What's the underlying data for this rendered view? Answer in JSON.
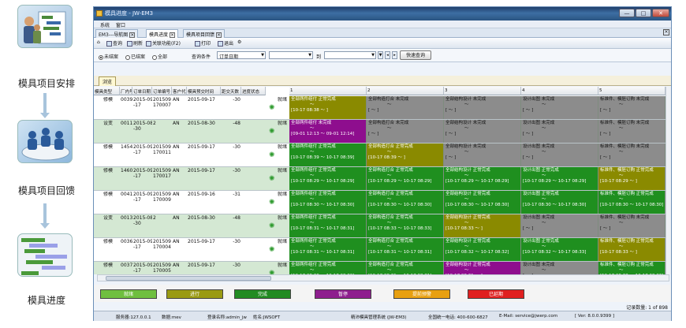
{
  "sidebar": {
    "items": [
      {
        "label": "模具项目安排",
        "icon": "schedule-people-icon"
      },
      {
        "label": "模具项目回馈",
        "icon": "meeting-feedback-icon"
      },
      {
        "label": "模具进度",
        "icon": "gantt-progress-icon"
      }
    ]
  },
  "window": {
    "title": "模具进度 - JW-EM3",
    "minimize": "—",
    "maximize": "□",
    "close": "✕"
  },
  "menu": {
    "system": "系统",
    "window": "窗口"
  },
  "tabs": [
    {
      "label": "EM3---导航图",
      "active": false
    },
    {
      "label": "模具进度",
      "active": true
    },
    {
      "label": "模具项目回馈",
      "active": false
    }
  ],
  "toolbar": {
    "query": "查询",
    "refresh": "刷新",
    "related": "关联功能(F2)",
    "print": "打印",
    "exit": "退出"
  },
  "filter": {
    "radio_incomplete": "未结案",
    "radio_complete": "已结案",
    "radio_all": "全部",
    "quick_label": "查询条件",
    "field_value": "订单日期",
    "to_label": "到",
    "quick_query": "快速查询"
  },
  "browse_tab": "浏览",
  "columns": {
    "type": "模具类型",
    "factory": "厂内号",
    "order_date": "订单日期",
    "order_no": "订单编号",
    "customer": "客户代号",
    "delivery": "模具预交时间",
    "days": "距交天数",
    "progress": "进度状态",
    "c1": "1",
    "c2": "2",
    "c3": "3",
    "c4": "4",
    "c5": "5"
  },
  "rows": [
    {
      "type": "修模",
      "factory": "0039",
      "date1": "2015-09",
      "date2": "-17",
      "order1": "201509",
      "order2": "170007",
      "cust": "AN",
      "delivery": "2015-09-17",
      "days": "-30",
      "status": "就绪",
      "stages": [
        {
          "l1": "全部两件组付 正常完成",
          "l2": "～",
          "l3": "[10-17 08:38 ～  ]",
          "color": "#8a8a00"
        },
        {
          "l1": "全部构造打合 未完成",
          "l2": "～",
          "l3": "[  ～  ]",
          "color": "#8c8c8c"
        },
        {
          "l1": "全部结构设计 未完成",
          "l2": "～",
          "l3": "[  ～  ]",
          "color": "#8c8c8c"
        },
        {
          "l1": "设计出图 未完成",
          "l2": "～",
          "l3": "[  ～  ]",
          "color": "#8c8c8c"
        },
        {
          "l1": "标准件、模胚订购 未完成",
          "l2": "～",
          "l3": "[  ～  ]",
          "color": "#8c8c8c"
        }
      ]
    },
    {
      "type": "设变",
      "factory": "0011",
      "date1": "2015-08",
      "date2": "-30",
      "order1": "2",
      "order2": "",
      "cust": "AN",
      "delivery": "2015-08-30",
      "days": "-48",
      "status": "就绪",
      "stages": [
        {
          "l1": "全部两件组付 未完成",
          "l2": "～",
          "l3": "[09-01 12:13 ～ 09-01 12:14]",
          "color": "#8e0e8e"
        },
        {
          "l1": "全部构造打合 未完成",
          "l2": "～",
          "l3": "[  ～  ]",
          "color": "#8c8c8c"
        },
        {
          "l1": "全部结构设计 未完成",
          "l2": "～",
          "l3": "[  ～  ]",
          "color": "#8c8c8c"
        },
        {
          "l1": "设计出图 未完成",
          "l2": "～",
          "l3": "[  ～  ]",
          "color": "#8c8c8c"
        },
        {
          "l1": "标准件、模胚订购 未完成",
          "l2": "～",
          "l3": "[  ～  ]",
          "color": "#8c8c8c"
        }
      ]
    },
    {
      "type": "修模",
      "factory": "1454",
      "date1": "2015-09",
      "date2": "-17",
      "order1": "201509",
      "order2": "170011",
      "cust": "AN",
      "delivery": "2015-09-17",
      "days": "-30",
      "status": "就绪",
      "stages": [
        {
          "l1": "全部两件组付 正常完成",
          "l2": "～",
          "l3": "[10-17 08:39 ～ 10-17 08:39]",
          "color": "#1f8f1f"
        },
        {
          "l1": "全部构造打合 正常完成",
          "l2": "～",
          "l3": "[10-17 08:39 ～  ]",
          "color": "#8a8a00"
        },
        {
          "l1": "全部结构设计 未完成",
          "l2": "～",
          "l3": "[  ～  ]",
          "color": "#8c8c8c"
        },
        {
          "l1": "设计出图 未完成",
          "l2": "～",
          "l3": "[  ～  ]",
          "color": "#8c8c8c"
        },
        {
          "l1": "标准件、模胚订购 未完成",
          "l2": "～",
          "l3": "[  ～  ]",
          "color": "#8c8c8c"
        }
      ]
    },
    {
      "type": "修模",
      "factory": "1460",
      "date1": "2015-09",
      "date2": "-17",
      "order1": "201509",
      "order2": "170017",
      "cust": "AN",
      "delivery": "2015-09-17",
      "days": "-30",
      "status": "就绪",
      "stages": [
        {
          "l1": "全部两件组付 正常完成",
          "l2": "～",
          "l3": "[10-17 08:29 ～ 10-17 08:29]",
          "color": "#1f8f1f"
        },
        {
          "l1": "全部构造打合 正常完成",
          "l2": "～",
          "l3": "[10-17 08:29 ～ 10-17 08:29]",
          "color": "#1f8f1f"
        },
        {
          "l1": "全部结构设计 正常完成",
          "l2": "～",
          "l3": "[10-17 08:29 ～ 10-17 08:29]",
          "color": "#1f8f1f"
        },
        {
          "l1": "设计出图 正常完成",
          "l2": "～",
          "l3": "[10-17 08:29 ～ 10-17 08:29]",
          "color": "#1f8f1f"
        },
        {
          "l1": "标准件、模胚订购 正常完成",
          "l2": "～",
          "l3": "[10-17 08:29 ～  ]",
          "color": "#8a8a00"
        }
      ]
    },
    {
      "type": "修模",
      "factory": "0041",
      "date1": "2015-09",
      "date2": "-17",
      "order1": "201509",
      "order2": "170009",
      "cust": "AN",
      "delivery": "2015-09-16",
      "days": "-31",
      "status": "就绪",
      "stages": [
        {
          "l1": "全部两件组付 正常完成",
          "l2": "～",
          "l3": "[10-17 08:30 ～ 10-17 08:30]",
          "color": "#1f8f1f"
        },
        {
          "l1": "全部构造打合 正常完成",
          "l2": "～",
          "l3": "[10-17 08:30 ～ 10-17 08:30]",
          "color": "#1f8f1f"
        },
        {
          "l1": "全部结构设计 正常完成",
          "l2": "～",
          "l3": "[10-17 08:30 ～ 10-17 08:30]",
          "color": "#1f8f1f"
        },
        {
          "l1": "设计出图 正常完成",
          "l2": "～",
          "l3": "[10-17 08:30 ～ 10-17 08:30]",
          "color": "#1f8f1f"
        },
        {
          "l1": "标准件、模胚订购 正常完成",
          "l2": "～",
          "l3": "[10-17 08:30 ～ 10-17 08:30]",
          "color": "#1f8f1f"
        }
      ]
    },
    {
      "type": "设变",
      "factory": "0013",
      "date1": "2015-08",
      "date2": "-30",
      "order1": "2",
      "order2": "",
      "cust": "AN",
      "delivery": "2015-08-30",
      "days": "-48",
      "status": "就绪",
      "stages": [
        {
          "l1": "全部两件组付 正常完成",
          "l2": "～",
          "l3": "[10-17 08:31 ～ 10-17 08:31]",
          "color": "#1f8f1f"
        },
        {
          "l1": "全部构造打合 正常完成",
          "l2": "～",
          "l3": "[10-17 08:33 ～ 10-17 08:33]",
          "color": "#1f8f1f"
        },
        {
          "l1": "全部结构设计 正常完成",
          "l2": "～",
          "l3": "[10-17 08:33 ～  ]",
          "color": "#8a8a00"
        },
        {
          "l1": "设计出图 未完成",
          "l2": "～",
          "l3": "[  ～  ]",
          "color": "#8c8c8c"
        },
        {
          "l1": "标准件、模胚订购 未完成",
          "l2": "～",
          "l3": "[  ～  ]",
          "color": "#8c8c8c"
        }
      ]
    },
    {
      "type": "修模",
      "factory": "0036",
      "date1": "2015-09",
      "date2": "-17",
      "order1": "201509",
      "order2": "170004",
      "cust": "AN",
      "delivery": "2015-09-17",
      "days": "-30",
      "status": "就绪",
      "stages": [
        {
          "l1": "全部两件组付 正常完成",
          "l2": "～",
          "l3": "[10-17 08:31 ～ 10-17 08:31]",
          "color": "#1f8f1f"
        },
        {
          "l1": "全部构造打合 正常完成",
          "l2": "～",
          "l3": "[10-17 08:31 ～ 10-17 08:31]",
          "color": "#1f8f1f"
        },
        {
          "l1": "全部结构设计 正常完成",
          "l2": "～",
          "l3": "[10-17 08:32 ～ 10-17 08:32]",
          "color": "#1f8f1f"
        },
        {
          "l1": "设计出图 正常完成",
          "l2": "～",
          "l3": "[10-17 08:32 ～ 10-17 08:33]",
          "color": "#1f8f1f"
        },
        {
          "l1": "标准件、模胚订购 正常完成",
          "l2": "～",
          "l3": "[10-17 08:33 ～  ]",
          "color": "#8a8a00"
        }
      ]
    },
    {
      "type": "修模",
      "factory": "0037",
      "date1": "2015-09",
      "date2": "-17",
      "order1": "201509",
      "order2": "170005",
      "cust": "AN",
      "delivery": "2015-09-17",
      "days": "-30",
      "status": "就绪",
      "stages": [
        {
          "l1": "全部两件组付 正常完成",
          "l2": "～",
          "l3": "[10-17 08:30 ～ 10-17 08:30]",
          "color": "#1f8f1f"
        },
        {
          "l1": "全部构造打合 正常完成",
          "l2": "～",
          "l3": "[10-17 08:31 ～ 10-17 08:31]",
          "color": "#1f8f1f"
        },
        {
          "l1": "全部结构设计 正常完成",
          "l2": "～",
          "l3": "[10-17 08:31 ～  ]",
          "color": "#8e0e8e"
        },
        {
          "l1": "设计出图 未完成",
          "l2": "～",
          "l3": "[  ～  ]",
          "color": "#8c8c8c"
        },
        {
          "l1": "标准件、模胚订购 正常完成",
          "l2": "～",
          "l3": "[10-17 08:33 ～ 10-17 08:33]",
          "color": "#1f8f1f"
        }
      ]
    }
  ],
  "legend": [
    {
      "label": "就绪",
      "color": "#6fbf3f"
    },
    {
      "label": "进行",
      "color": "#9a9a12"
    },
    {
      "label": "完成",
      "color": "#228b22"
    },
    {
      "label": "暂停",
      "color": "#8e1e8e"
    },
    {
      "label": "提前预警",
      "color": "#e8a010"
    },
    {
      "label": "已延期",
      "color": "#e02020"
    }
  ],
  "record_count": "记录数量: 1 of 898",
  "status": {
    "server": "服务器:127.0.0.1",
    "db": "数据:mev",
    "login": "登录名称:admin_jw",
    "company": "姓名:JWSOFT",
    "system": "精沛模具管理系统 (JW-EM3)",
    "hotline": "全国统一电话: 400-600-6827",
    "email": "E-Mail: service@jwerp.com",
    "version": "[ Ver: 8.0.0.9399 ]"
  }
}
